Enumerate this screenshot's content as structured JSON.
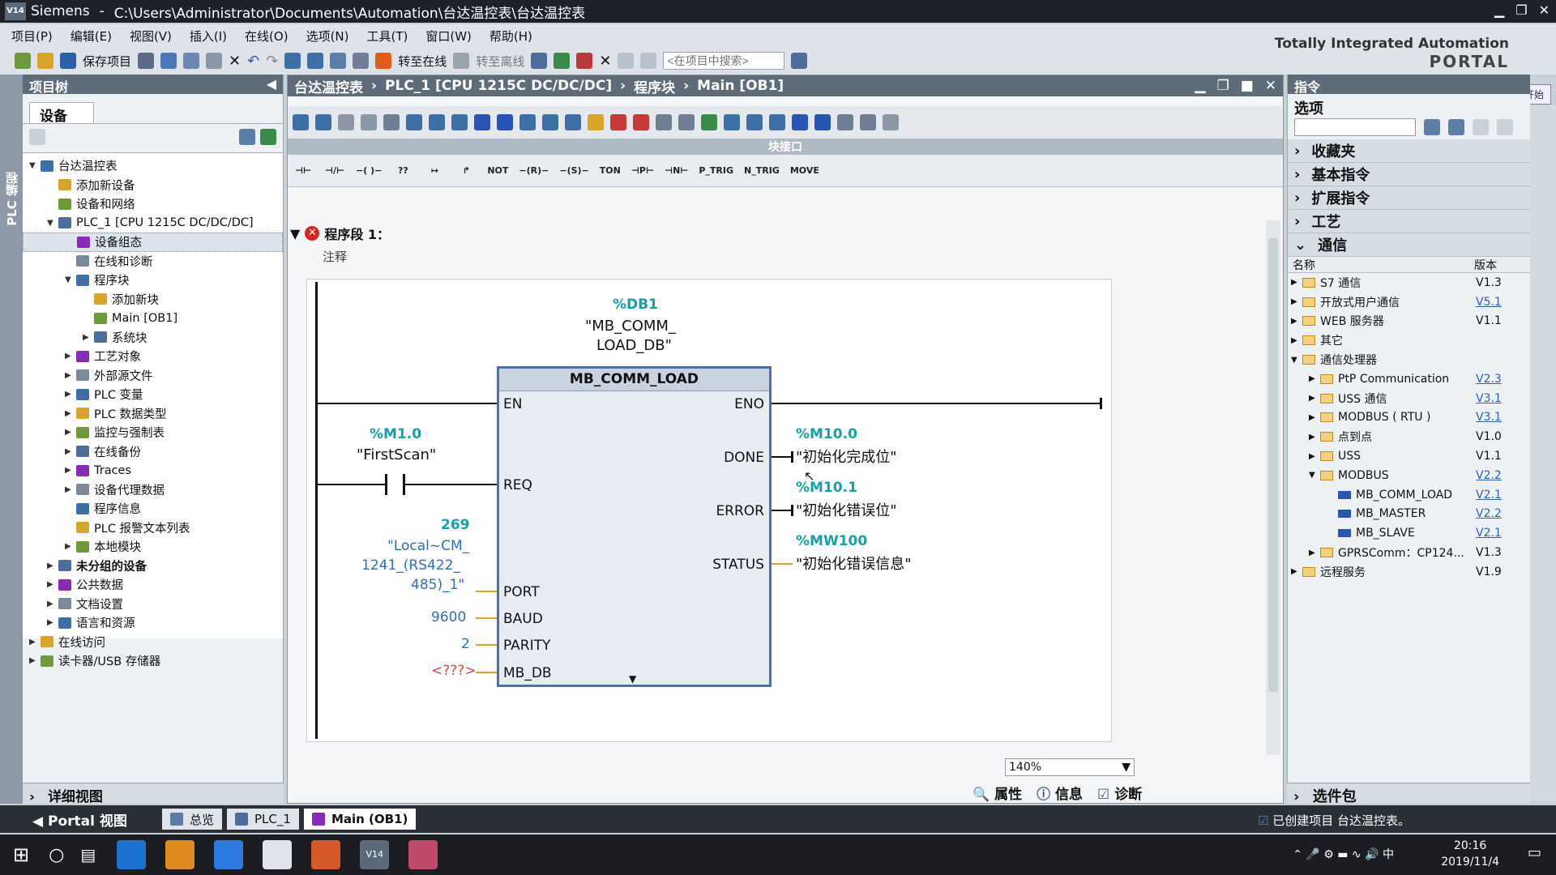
{
  "window": {
    "app": "Siemens",
    "path": "C:\\Users\\Administrator\\Documents\\Automation\\台达温控表\\台达温控表"
  },
  "menu": [
    "项目(P)",
    "编辑(E)",
    "视图(V)",
    "插入(I)",
    "在线(O)",
    "选项(N)",
    "工具(T)",
    "窗口(W)",
    "帮助(H)"
  ],
  "toolbar": {
    "save": "保存项目",
    "go_online": "转至在线",
    "go_offline": "转至离线",
    "search_placeholder": "<在项目中搜索>"
  },
  "brand": {
    "line1": "Totally Integrated Automation",
    "line2": "PORTAL",
    "start": "开始"
  },
  "left": {
    "strip": "PLC 编程",
    "title": "项目树",
    "tab": "设备",
    "detail": "详细视图"
  },
  "tree": [
    {
      "t": "台达温控表",
      "lv": 0,
      "a": "▼"
    },
    {
      "t": "添加新设备",
      "lv": 1,
      "a": ""
    },
    {
      "t": "设备和网络",
      "lv": 1,
      "a": ""
    },
    {
      "t": "PLC_1 [CPU 1215C DC/DC/DC]",
      "lv": 1,
      "a": "▼"
    },
    {
      "t": "设备组态",
      "lv": 2,
      "a": "",
      "sel": true
    },
    {
      "t": "在线和诊断",
      "lv": 2,
      "a": ""
    },
    {
      "t": "程序块",
      "lv": 2,
      "a": "▼"
    },
    {
      "t": "添加新块",
      "lv": 3,
      "a": ""
    },
    {
      "t": "Main [OB1]",
      "lv": 3,
      "a": ""
    },
    {
      "t": "系统块",
      "lv": 3,
      "a": "▶"
    },
    {
      "t": "工艺对象",
      "lv": 2,
      "a": "▶"
    },
    {
      "t": "外部源文件",
      "lv": 2,
      "a": "▶"
    },
    {
      "t": "PLC 变量",
      "lv": 2,
      "a": "▶"
    },
    {
      "t": "PLC 数据类型",
      "lv": 2,
      "a": "▶"
    },
    {
      "t": "监控与强制表",
      "lv": 2,
      "a": "▶"
    },
    {
      "t": "在线备份",
      "lv": 2,
      "a": "▶"
    },
    {
      "t": "Traces",
      "lv": 2,
      "a": "▶"
    },
    {
      "t": "设备代理数据",
      "lv": 2,
      "a": "▶"
    },
    {
      "t": "程序信息",
      "lv": 2,
      "a": ""
    },
    {
      "t": "PLC 报警文本列表",
      "lv": 2,
      "a": ""
    },
    {
      "t": "本地模块",
      "lv": 2,
      "a": "▶"
    },
    {
      "t": "未分组的设备",
      "lv": 1,
      "a": "▶",
      "b": true
    },
    {
      "t": "公共数据",
      "lv": 1,
      "a": "▶"
    },
    {
      "t": "文档设置",
      "lv": 1,
      "a": "▶"
    },
    {
      "t": "语言和资源",
      "lv": 1,
      "a": "▶"
    },
    {
      "t": "在线访问",
      "lv": 0,
      "a": "▶"
    },
    {
      "t": "读卡器/USB 存储器",
      "lv": 0,
      "a": "▶"
    }
  ],
  "editor": {
    "crumbs": [
      "台达温控表",
      "PLC_1 [CPU 1215C DC/DC/DC]",
      "程序块",
      "Main [OB1]"
    ],
    "iface": "块接口",
    "ladder": [
      "⊣⊢",
      "⊣/⊢",
      "−( )−",
      "??",
      "↦",
      "↱",
      "NOT",
      "−(R)−",
      "−(S)−",
      "TON",
      "⊣P⊢",
      "⊣N⊢",
      "P_TRIG",
      "N_TRIG",
      "MOVE"
    ],
    "network": "程序段 1：",
    "comment": "注释",
    "zoom": "140%"
  },
  "block": {
    "db_addr": "%DB1",
    "db_name1": "\"MB_COMM_",
    "db_name2": "LOAD_DB\"",
    "title": "MB_COMM_LOAD",
    "in": [
      "EN",
      "REQ",
      "PORT",
      "BAUD",
      "PARITY",
      "MB_DB"
    ],
    "out": [
      "ENO",
      "DONE",
      "ERROR",
      "STATUS"
    ],
    "req_addr": "%M1.0",
    "req_name": "\"FirstScan\"",
    "port_val": "269",
    "port_n1": "\"Local~CM_",
    "port_n2": "1241_(RS422_",
    "port_n3": "485)_1\"",
    "baud": "9600",
    "parity": "2",
    "mbdb": "<???>",
    "done_addr": "%M10.0",
    "done_name": "\"初始化完成位\"",
    "err_addr": "%M10.1",
    "err_name": "\"初始化错误位\"",
    "st_addr": "%MW100",
    "st_name": "\"初始化错误信息\""
  },
  "right": {
    "title": "指令",
    "options": "选项",
    "sections": [
      "收藏夹",
      "基本指令",
      "扩展指令",
      "工艺",
      "通信"
    ],
    "col_name": "名称",
    "col_ver": "版本",
    "items": [
      {
        "t": "S7 通信",
        "v": "V1.3",
        "lv": 0,
        "a": "▶",
        "k": "f"
      },
      {
        "t": "开放式用户通信",
        "v": "V5.1",
        "lv": 0,
        "a": "▶",
        "k": "f",
        "l": true
      },
      {
        "t": "WEB 服务器",
        "v": "V1.1",
        "lv": 0,
        "a": "▶",
        "k": "f"
      },
      {
        "t": "其它",
        "v": "",
        "lv": 0,
        "a": "▶",
        "k": "f"
      },
      {
        "t": "通信处理器",
        "v": "",
        "lv": 0,
        "a": "▼",
        "k": "f"
      },
      {
        "t": "PtP Communication",
        "v": "V2.3",
        "lv": 1,
        "a": "▶",
        "k": "f",
        "l": true
      },
      {
        "t": "USS 通信",
        "v": "V3.1",
        "lv": 1,
        "a": "▶",
        "k": "f",
        "l": true
      },
      {
        "t": "MODBUS ( RTU )",
        "v": "V3.1",
        "lv": 1,
        "a": "▶",
        "k": "f",
        "l": true
      },
      {
        "t": "点到点",
        "v": "V1.0",
        "lv": 1,
        "a": "▶",
        "k": "f"
      },
      {
        "t": "USS",
        "v": "V1.1",
        "lv": 1,
        "a": "▶",
        "k": "f"
      },
      {
        "t": "MODBUS",
        "v": "V2.2",
        "lv": 1,
        "a": "▼",
        "k": "f",
        "l": true
      },
      {
        "t": "MB_COMM_LOAD",
        "v": "V2.1",
        "lv": 2,
        "a": "",
        "k": "b",
        "l": true
      },
      {
        "t": "MB_MASTER",
        "v": "V2.2",
        "lv": 2,
        "a": "",
        "k": "b",
        "l": true
      },
      {
        "t": "MB_SLAVE",
        "v": "V2.1",
        "lv": 2,
        "a": "",
        "k": "b",
        "l": true
      },
      {
        "t": "GPRSComm：CP124...",
        "v": "V1.3",
        "lv": 1,
        "a": "▶",
        "k": "f"
      },
      {
        "t": "远程服务",
        "v": "V1.9",
        "lv": 0,
        "a": "▶",
        "k": "f"
      }
    ],
    "pkg": "选件包"
  },
  "props": {
    "p": "属性",
    "i": "信息",
    "d": "诊断"
  },
  "bottom": {
    "portal": "Portal 视图",
    "tabs": [
      "总览",
      "PLC_1",
      "Main (OB1)"
    ],
    "status": "已创建项目 台达温控表。"
  },
  "clock": {
    "time": "20:16",
    "date": "2019/11/4",
    "ime": "中"
  }
}
